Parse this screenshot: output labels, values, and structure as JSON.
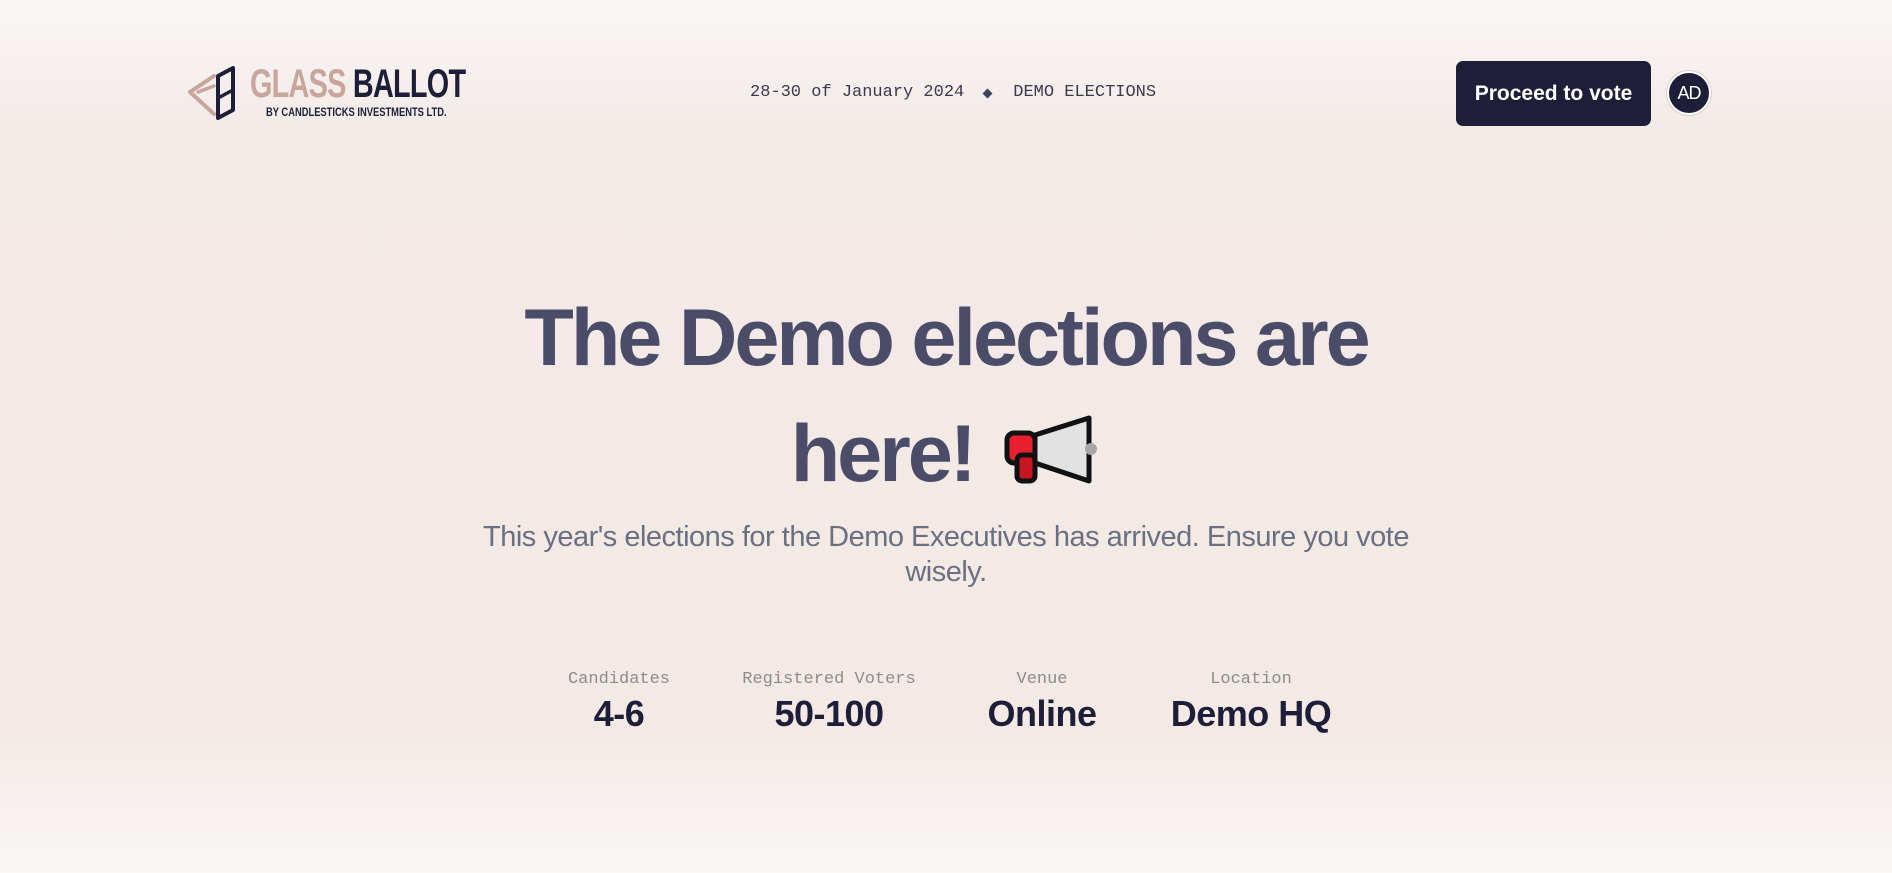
{
  "header": {
    "logo": {
      "title_part1": "GLASS",
      "title_part2": "BALLOT",
      "subtitle": "BY CANDLESTICKS INVESTMENTS LTD."
    },
    "event_dates": "28-30 of January 2024",
    "event_name": "DEMO ELECTIONS",
    "proceed_button_label": "Proceed to vote",
    "avatar_initials": "AD"
  },
  "hero": {
    "title_line1": "The Demo elections are",
    "title_line2": "here!",
    "title_icon": "megaphone-icon",
    "subtitle": "This year's elections for the Demo Executives has arrived. Ensure you vote wisely."
  },
  "stats": [
    {
      "label": "Candidates",
      "value": "4-6"
    },
    {
      "label": "Registered Voters",
      "value": "50-100"
    },
    {
      "label": "Venue",
      "value": "Online"
    },
    {
      "label": "Location",
      "value": "Demo HQ"
    }
  ],
  "colors": {
    "primary": "#1e1e38",
    "logo_accent": "#c8a59d",
    "heading": "#4a4c68",
    "subtitle": "#6b7080",
    "background": "#f3ebe8"
  }
}
